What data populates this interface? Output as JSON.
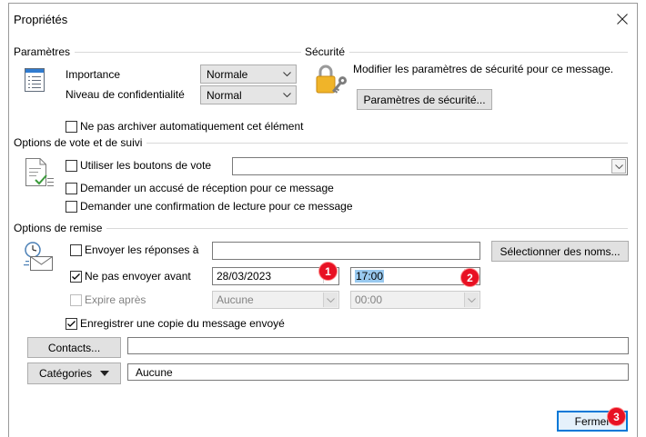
{
  "window": {
    "title": "Propriétés"
  },
  "settings": {
    "section_label": "Paramètres",
    "importance": {
      "label": "Importance",
      "value": "Normale"
    },
    "sensitivity": {
      "label": "Niveau de confidentialité",
      "value": "Normal"
    },
    "no_autoarchive": {
      "label": "Ne pas archiver automatiquement cet élément",
      "checked": false
    }
  },
  "security": {
    "section_label": "Sécurité",
    "description": "Modifier les paramètres de sécurité pour ce message.",
    "button_label": "Paramètres de sécurité..."
  },
  "voting": {
    "section_label": "Options de vote et de suivi",
    "use_voting_buttons": {
      "label": "Utiliser les boutons de vote",
      "checked": false,
      "value": ""
    },
    "delivery_receipt": {
      "label": "Demander un accusé de réception pour ce message",
      "checked": false
    },
    "read_receipt": {
      "label": "Demander une confirmation de lecture pour ce message",
      "checked": false
    }
  },
  "delivery": {
    "section_label": "Options de remise",
    "replies_to": {
      "label": "Envoyer les réponses à",
      "checked": false,
      "value": ""
    },
    "select_names_label": "Sélectionner des noms...",
    "do_not_deliver_before": {
      "label": "Ne pas envoyer avant",
      "checked": true,
      "date": "28/03/2023",
      "time": "17:00"
    },
    "expires_after": {
      "label": "Expire après",
      "checked": false,
      "disabled": true,
      "date": "Aucune",
      "time": "00:00"
    },
    "save_sent_copy": {
      "label": "Enregistrer une copie du message envoyé",
      "checked": true
    }
  },
  "contacts": {
    "button_label": "Contacts...",
    "value": ""
  },
  "categories": {
    "button_label": "Catégories",
    "value": "Aucune"
  },
  "footer": {
    "close_label": "Fermer"
  },
  "annotations": [
    "1",
    "2",
    "3"
  ],
  "icons": {
    "close": "close-icon",
    "settings": "properties-list-icon",
    "security": "padlock-key-icon",
    "voting": "voting-checklist-icon",
    "delivery": "clock-envelope-icon",
    "dropdown": "chevron-down-icon",
    "check": "checkmark-icon"
  },
  "colors": {
    "accent": "#0078d7",
    "annotation_badge": "#e81123",
    "text_selection": "#99c9ef",
    "disabled_text": "#838383",
    "lock_body": "#f0b429"
  }
}
